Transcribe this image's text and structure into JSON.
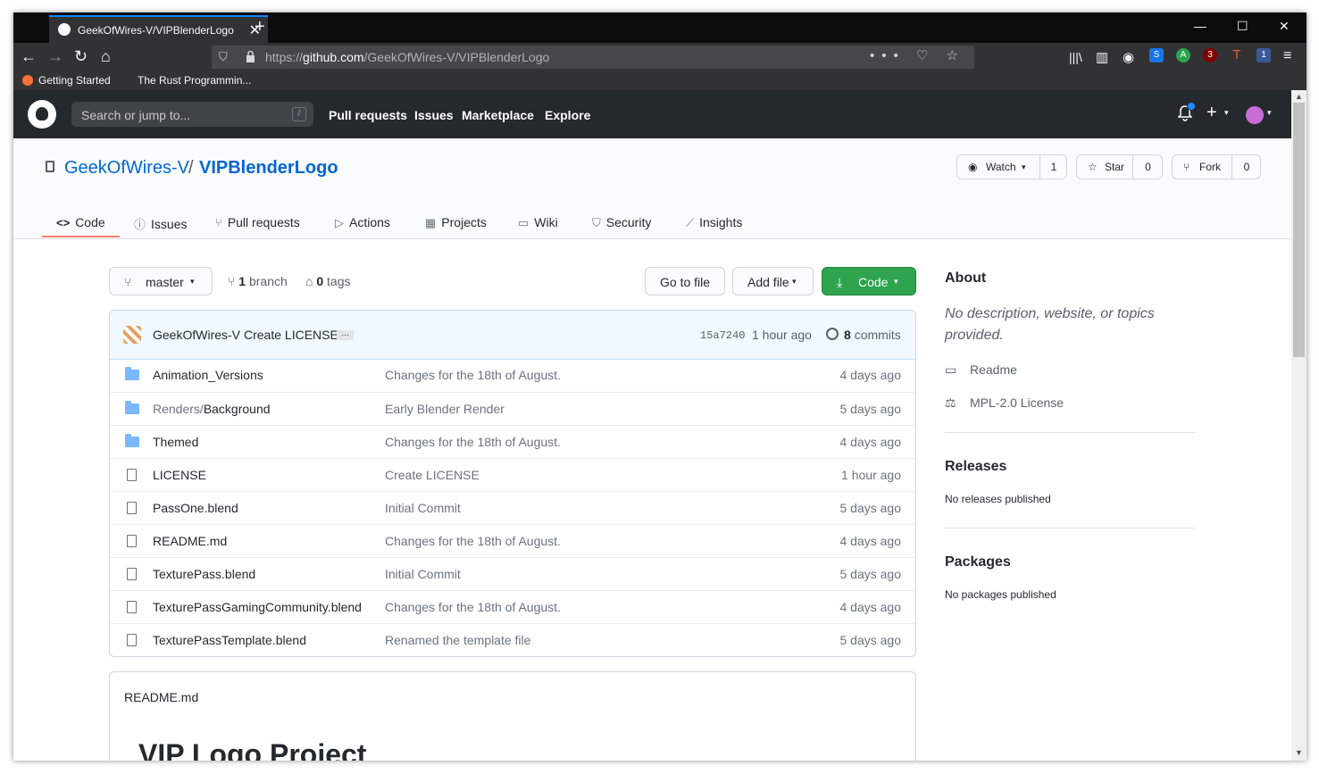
{
  "browser": {
    "tab_title": "GeekOfWires-V/VIPBlenderLogo",
    "tab_close": "✕",
    "new_tab": "+",
    "window_controls": [
      "—",
      "☐",
      "✕"
    ],
    "url_prefix": "https://",
    "url_domain": "github.com",
    "url_path": "/GeekOfWires-V/VIPBlenderLogo",
    "url_actions": "••• ♡ ☆",
    "ext_badges": [
      "S",
      "A",
      "3",
      "T",
      "1"
    ],
    "bookmarks": [
      "Getting Started",
      "The Rust Programmin..."
    ]
  },
  "github": {
    "search_placeholder": "Search or jump to...",
    "search_key": "/",
    "nav": [
      "Pull requests",
      "Issues",
      "Marketplace",
      "Explore"
    ],
    "plus": "+",
    "caret": "▾"
  },
  "repo": {
    "owner": "GeekOfWires-V",
    "sep": "/",
    "name": "VIPBlenderLogo",
    "watch": {
      "label": "Watch",
      "count": "1"
    },
    "star": {
      "label": "Star",
      "count": "0"
    },
    "fork": {
      "label": "Fork",
      "count": "0"
    },
    "tabs": [
      {
        "label": "Code",
        "icon": "<>"
      },
      {
        "label": "Issues",
        "icon": "ⓘ"
      },
      {
        "label": "Pull requests",
        "icon": "⑂"
      },
      {
        "label": "Actions",
        "icon": "▷"
      },
      {
        "label": "Projects",
        "icon": "▦"
      },
      {
        "label": "Wiki",
        "icon": "▭"
      },
      {
        "label": "Security",
        "icon": "⛉"
      },
      {
        "label": "Insights",
        "icon": "⟋"
      }
    ]
  },
  "toolbar": {
    "branch": "master",
    "branch_count": "1",
    "branch_label": "branch",
    "tags_count": "0",
    "tags_label": "tags",
    "go_to_file": "Go to file",
    "add_file": "Add file",
    "code": "Code"
  },
  "commit": {
    "author": "GeekOfWires-V",
    "message": "Create LICENSE",
    "ellipsis": "...",
    "sha": "15a7240",
    "time": "1 hour ago",
    "count": "8",
    "count_label": "commits"
  },
  "files": [
    {
      "type": "dir",
      "name": "Animation_Versions",
      "name_prefix": "",
      "message": "Changes for the 18th of August.",
      "age": "4 days ago"
    },
    {
      "type": "dir",
      "name": "Background",
      "name_prefix": "Renders/",
      "message": "Early Blender Render",
      "age": "5 days ago"
    },
    {
      "type": "dir",
      "name": "Themed",
      "name_prefix": "",
      "message": "Changes for the 18th of August.",
      "age": "4 days ago"
    },
    {
      "type": "file",
      "name": "LICENSE",
      "name_prefix": "",
      "message": "Create LICENSE",
      "age": "1 hour ago"
    },
    {
      "type": "file",
      "name": "PassOne.blend",
      "name_prefix": "",
      "message": "Initial Commit",
      "age": "5 days ago"
    },
    {
      "type": "file",
      "name": "README.md",
      "name_prefix": "",
      "message": "Changes for the 18th of August.",
      "age": "4 days ago"
    },
    {
      "type": "file",
      "name": "TexturePass.blend",
      "name_prefix": "",
      "message": "Initial Commit",
      "age": "5 days ago"
    },
    {
      "type": "file",
      "name": "TexturePassGamingCommunity.blend",
      "name_prefix": "",
      "message": "Changes for the 18th of August.",
      "age": "4 days ago"
    },
    {
      "type": "file",
      "name": "TexturePassTemplate.blend",
      "name_prefix": "",
      "message": "Renamed the template file",
      "age": "5 days ago"
    }
  ],
  "readme": {
    "filename": "README.md",
    "heading": "VIP Logo Project"
  },
  "sidebar": {
    "about_title": "About",
    "about_desc": "No description, website, or topics provided.",
    "readme_link": "Readme",
    "license_link": "MPL-2.0 License",
    "releases_title": "Releases",
    "releases_text": "No releases published",
    "packages_title": "Packages",
    "packages_text": "No packages published"
  },
  "colors": {
    "accent_blue": "#0366d6",
    "green_button": "#2ea44f",
    "header_dark": "#24292e",
    "tab_underline": "#f9826c"
  }
}
